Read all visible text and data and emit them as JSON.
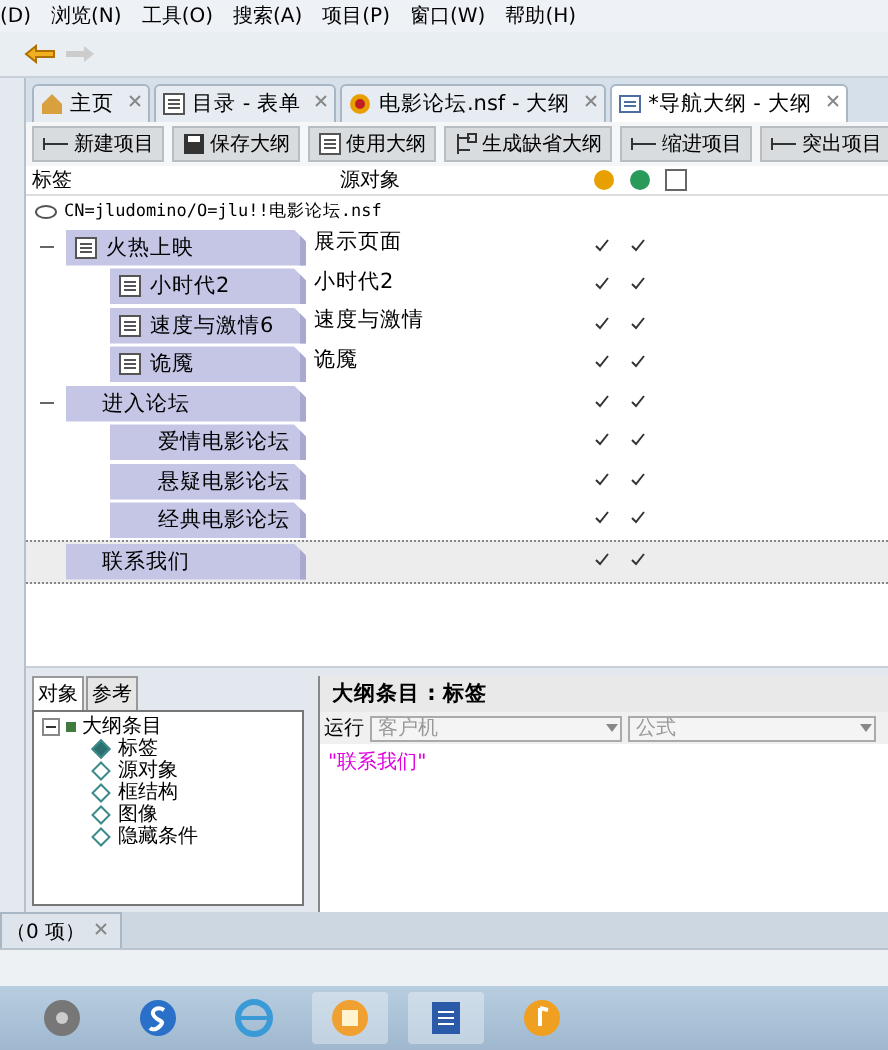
{
  "menu": [
    "(D)",
    "浏览(N)",
    "工具(O)",
    "搜索(A)",
    "项目(P)",
    "窗口(W)",
    "帮助(H)"
  ],
  "tabs": [
    {
      "label": "主页",
      "selected": false
    },
    {
      "label": "目录 - 表单",
      "selected": false
    },
    {
      "label": "电影论坛.nsf - 大纲",
      "selected": false
    },
    {
      "label": "*导航大纲 - 大纲",
      "selected": true
    }
  ],
  "toolbar_buttons": [
    "新建项目",
    "保存大纲",
    "使用大纲",
    "生成缺省大纲",
    "缩进项目",
    "突出项目"
  ],
  "outline": {
    "columns": [
      "标签",
      "源对象"
    ],
    "root": "CN=jludomino/O=jlu!!电影论坛.nsf",
    "items": [
      {
        "label": "火热上映",
        "source": "展示页面",
        "has_icon": true,
        "expanded": true,
        "selected": false,
        "checks": [
          true,
          true
        ],
        "children": [
          {
            "label": "小时代2",
            "source": "小时代2",
            "has_icon": true,
            "selected": false,
            "checks": [
              true,
              true
            ]
          },
          {
            "label": "速度与激情6",
            "source": "速度与激情",
            "has_icon": true,
            "selected": false,
            "checks": [
              true,
              true
            ]
          },
          {
            "label": "诡魇",
            "source": "诡魇",
            "has_icon": true,
            "selected": false,
            "checks": [
              true,
              true
            ]
          }
        ]
      },
      {
        "label": "进入论坛",
        "has_icon": false,
        "expanded": true,
        "selected": false,
        "checks": [
          true,
          true
        ],
        "children": [
          {
            "label": "爱情电影论坛",
            "has_icon": false,
            "selected": false,
            "checks": [
              true,
              true
            ]
          },
          {
            "label": "悬疑电影论坛",
            "has_icon": false,
            "selected": false,
            "checks": [
              true,
              true
            ]
          },
          {
            "label": "经典电影论坛",
            "has_icon": false,
            "selected": false,
            "checks": [
              true,
              true
            ]
          }
        ]
      },
      {
        "label": "联系我们",
        "has_icon": false,
        "selected": true,
        "checks": [
          true,
          true
        ]
      }
    ]
  },
  "objects_panel": {
    "tabs": [
      {
        "label": "对象",
        "selected": true
      },
      {
        "label": "参考",
        "selected": false
      }
    ],
    "tree": {
      "label": "大纲条目",
      "expanded": true,
      "children": [
        {
          "label": "标签",
          "selected": true
        },
        {
          "label": "源对象",
          "selected": false
        },
        {
          "label": "框结构",
          "selected": false
        },
        {
          "label": "图像",
          "selected": false
        },
        {
          "label": "隐藏条件",
          "selected": false
        }
      ]
    }
  },
  "code_panel": {
    "title": "大纲条目 : 标签",
    "run_label": "运行",
    "run_target": "客户机",
    "language": "公式",
    "code": "\"联系我们\""
  },
  "bottom_tab": {
    "label": "（0 项）"
  }
}
